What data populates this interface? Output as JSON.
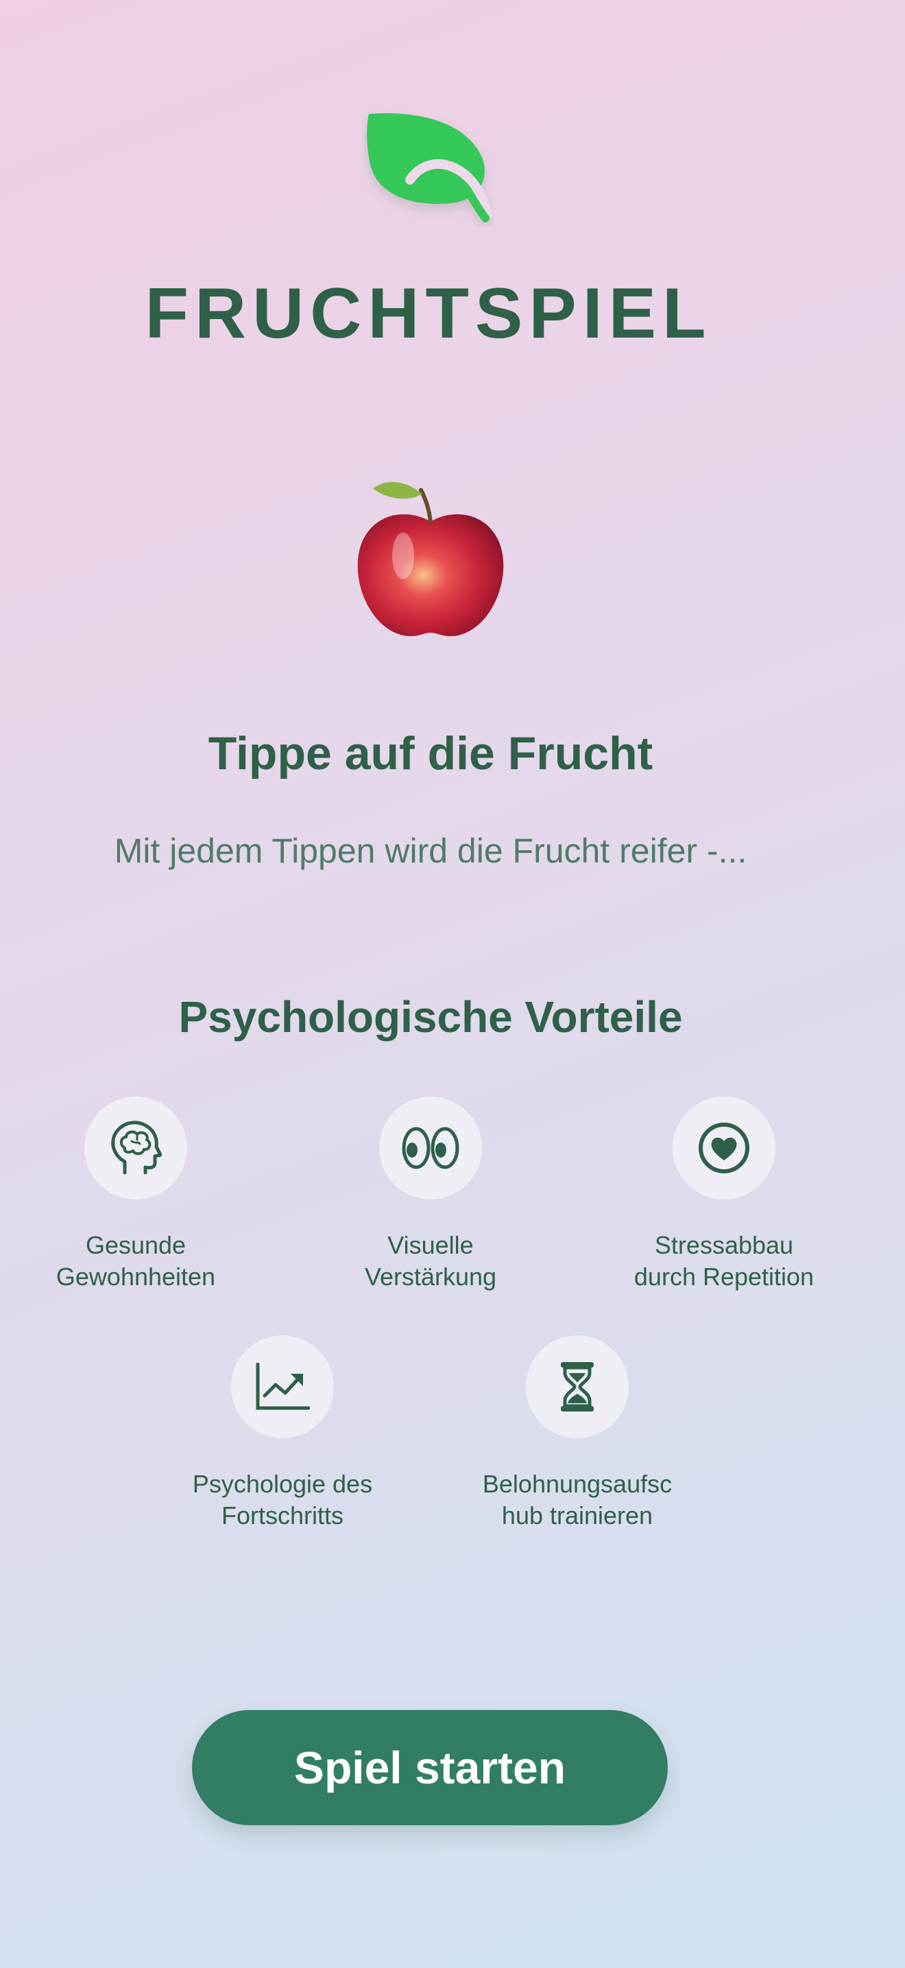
{
  "app": {
    "title": "FRUCHTSPIEL",
    "logo_icon": "leaf-icon"
  },
  "fruit": {
    "icon": "apple-icon"
  },
  "instruction": {
    "title": "Tippe auf die Frucht",
    "text": "Mit jedem Tippen wird die Frucht reifer -..."
  },
  "benefits": {
    "title": "Psychologische Vorteile",
    "items": [
      {
        "icon": "brain-head-icon",
        "label": "Gesunde\nGewohnheiten"
      },
      {
        "icon": "eyes-icon",
        "label": "Visuelle\nVerstärkung"
      },
      {
        "icon": "heart-circle-icon",
        "label": "Stressabbau\ndurch Repetition"
      },
      {
        "icon": "chart-trend-up-icon",
        "label": "Psychologie des\nFortschritts"
      },
      {
        "icon": "hourglass-icon",
        "label": "Belohnungsaufsc\nhub trainieren"
      }
    ]
  },
  "actions": {
    "start_label": "Spiel starten"
  },
  "colors": {
    "primary": "#2f6048",
    "button": "#317e63",
    "leaf": "#34c759",
    "icon_bg": "#efeef5"
  }
}
